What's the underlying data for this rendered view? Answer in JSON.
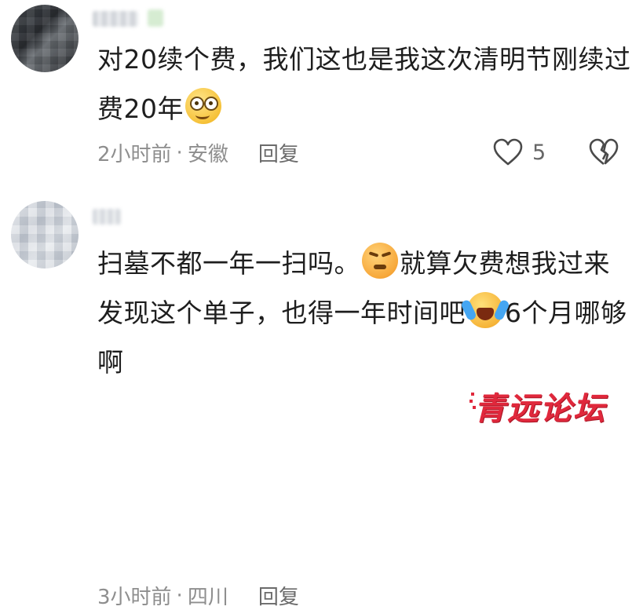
{
  "comments": [
    {
      "text_part1": "对20续个费，我们这也是我这次清明节刚续过费20年",
      "emoji": "smile-emoji",
      "time": "2小时前",
      "separator": "·",
      "location": "安徽",
      "reply_label": "回复",
      "like_count": "5"
    },
    {
      "text_part1": "扫墓不都一年一扫吗。",
      "emoji1": "sweat-emoji",
      "text_part2": "就算欠费想我过来发现这个单子，也得一年时间吧",
      "emoji2": "crying-laughing-emoji",
      "text_part3": "6个月哪够啊",
      "time": "3小时前",
      "separator": "·",
      "location": "四川",
      "reply_label": "回复"
    }
  ],
  "watermark": "青远论坛",
  "colors": {
    "text": "#1e1e1e",
    "meta": "#8e8e8e",
    "watermark": "#e0283c"
  }
}
